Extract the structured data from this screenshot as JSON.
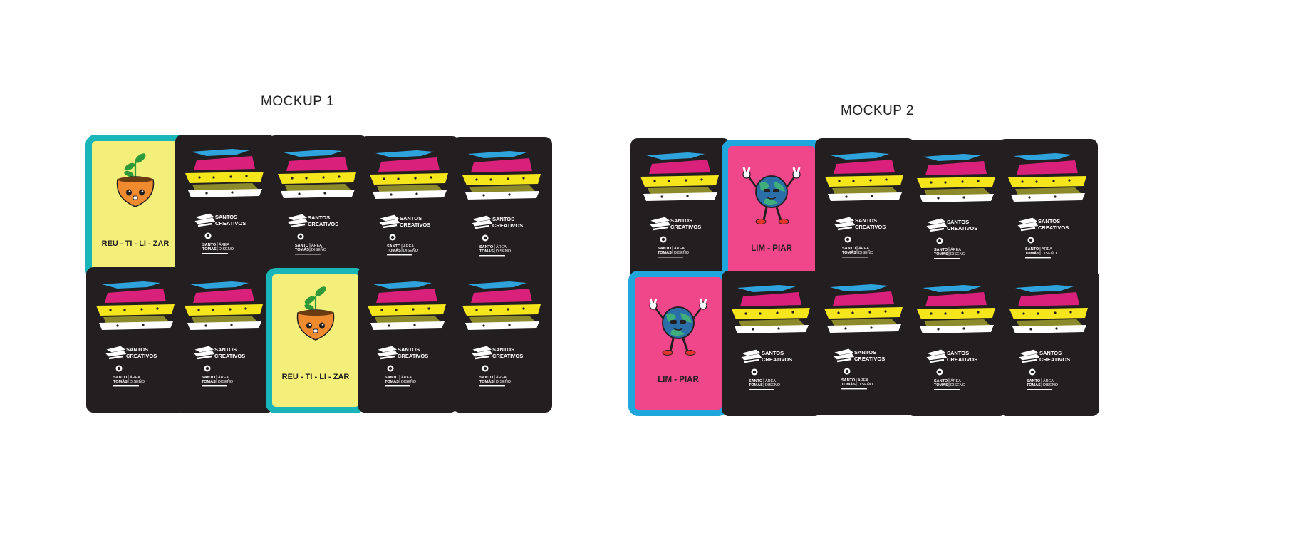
{
  "mockups": [
    {
      "title": "MOCKUP 1",
      "rows": [
        [
          {
            "face": true,
            "variant": "plant"
          },
          {
            "face": false
          },
          {
            "face": false
          },
          {
            "face": false
          },
          {
            "face": false
          }
        ],
        [
          {
            "face": false
          },
          {
            "face": false
          },
          {
            "face": true,
            "variant": "plant"
          },
          {
            "face": false
          },
          {
            "face": false
          }
        ]
      ]
    },
    {
      "title": "MOCKUP 2",
      "rows": [
        [
          {
            "face": false
          },
          {
            "face": true,
            "variant": "earth"
          },
          {
            "face": false
          },
          {
            "face": false
          },
          {
            "face": false
          }
        ],
        [
          {
            "face": true,
            "variant": "earth"
          },
          {
            "face": false
          },
          {
            "face": false
          },
          {
            "face": false
          },
          {
            "face": false
          }
        ]
      ]
    }
  ],
  "card_back": {
    "brand_line1": "SANTOS",
    "brand_line2": "CREATIVOS",
    "uni_line1": "SANTO",
    "uni_line2": "TOMÁS",
    "area_line1": "ÁREA",
    "area_line2": "DISEÑO",
    "icons": [
      "stripes-logo-icon",
      "santos-creativos-logo-icon",
      "santo-tomas-seal-icon"
    ]
  },
  "variants": {
    "plant": {
      "label": "REU - TI - LI - ZAR",
      "icon": "plant-pot-icon",
      "colors": {
        "bg": "#f4ef7a",
        "border": "#18b6b8",
        "pot": "#ef8a2e",
        "leaf": "#2e9a3a"
      }
    },
    "earth": {
      "label": "LIM - PIAR",
      "icon": "earth-mascot-icon",
      "colors": {
        "bg": "#f0468a",
        "border": "#1fa6dc",
        "ocean": "#2a6fa8",
        "land": "#3fae7a"
      }
    }
  },
  "stripe_colors": {
    "blue": "#2ea3dc",
    "magenta": "#d9207a",
    "yellow": "#f4e61a",
    "white": "#ffffff",
    "olive": "#8c8a2a"
  }
}
